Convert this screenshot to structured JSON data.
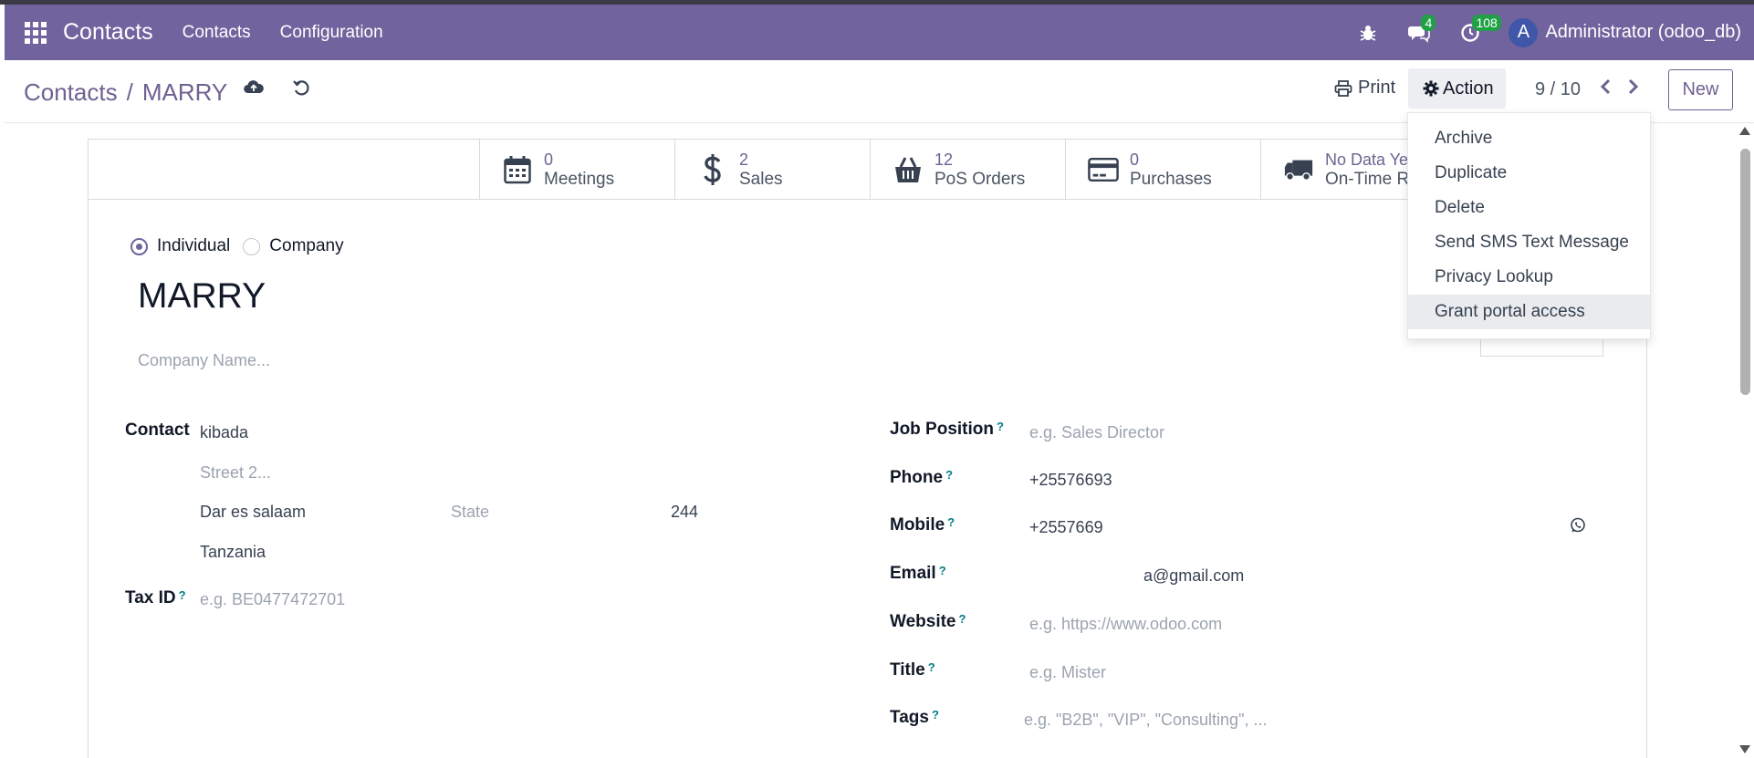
{
  "navbar": {
    "app_name": "Contacts",
    "menu": [
      "Contacts",
      "Configuration"
    ],
    "messages_badge": "4",
    "activities_badge": "108",
    "avatar_letter": "A",
    "user": "Administrator (odoo_db)"
  },
  "control": {
    "breadcrumb_parent": "Contacts",
    "breadcrumb_sep": "/",
    "breadcrumb_current": "MARRY",
    "print_label": "Print",
    "action_label": "Action",
    "pager": "9 / 10",
    "new_label": "New"
  },
  "smart_buttons": [
    {
      "value": "0",
      "label": "Meetings",
      "icon": "calendar-icon"
    },
    {
      "value": "2",
      "label": "Sales",
      "icon": "dollar-icon"
    },
    {
      "value": "12",
      "label": "PoS Orders",
      "icon": "shopping-bag-icon"
    },
    {
      "value": "0",
      "label": "Purchases",
      "icon": "credit-card-icon"
    },
    {
      "value": "No Data Ye",
      "label": "On-Time R",
      "icon": "truck-icon"
    }
  ],
  "form": {
    "type_individual": "Individual",
    "type_company": "Company",
    "name": "MARRY",
    "company_placeholder": "Company Name...",
    "contact_label": "Contact",
    "street": "kibada",
    "street2_placeholder": "Street 2...",
    "city": "Dar es salaam",
    "state_placeholder": "State",
    "zip": "244",
    "country": "Tanzania",
    "taxid_label": "Tax ID",
    "taxid_placeholder": "e.g. BE0477472701",
    "job_label": "Job Position",
    "job_placeholder": "e.g. Sales Director",
    "phone_label": "Phone",
    "phone": "+25576693",
    "mobile_label": "Mobile",
    "mobile": "+2557669",
    "email_label": "Email",
    "email": "a@gmail.com",
    "website_label": "Website",
    "website_placeholder": "e.g. https://www.odoo.com",
    "title_label": "Title",
    "title_placeholder": "e.g. Mister",
    "tags_label": "Tags",
    "tags_placeholder": "e.g. \"B2B\", \"VIP\", \"Consulting\", ...",
    "help_mark": "?"
  },
  "action_menu": [
    "Archive",
    "Duplicate",
    "Delete",
    "Send SMS Text Message",
    "Privacy Lookup",
    "Grant portal access"
  ],
  "colors": {
    "navbar": "#71639e",
    "accent": "#6f6292",
    "badge": "#21a146",
    "help": "#017e84"
  }
}
